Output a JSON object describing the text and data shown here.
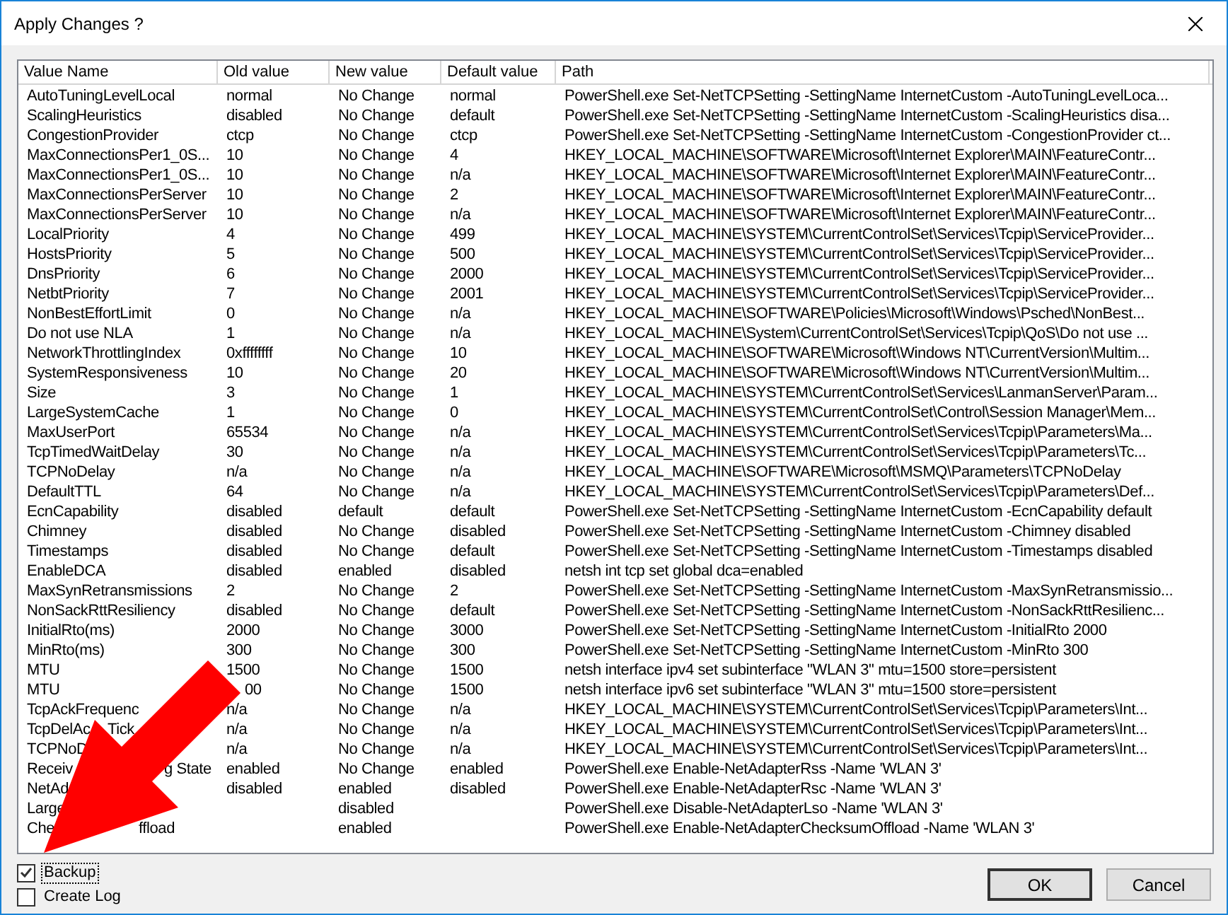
{
  "window": {
    "title": "Apply Changes ?"
  },
  "table": {
    "columns": [
      "Value Name",
      "Old value",
      "New value",
      "Default value",
      "Path"
    ],
    "rows": [
      {
        "name": [
          "AutoTuningLevelLocal"
        ],
        "old": "normal",
        "new": "No Change",
        "default": "normal",
        "path": "PowerShell.exe Set-NetTCPSetting -SettingName InternetCustom -AutoTuningLevelLoca..."
      },
      {
        "name": [
          "ScalingHeuristics"
        ],
        "old": "disabled",
        "new": "No Change",
        "default": "default",
        "path": "PowerShell.exe Set-NetTCPSetting -SettingName InternetCustom -ScalingHeuristics disa..."
      },
      {
        "name": [
          "CongestionProvider"
        ],
        "old": "ctcp",
        "new": "No Change",
        "default": "ctcp",
        "path": "PowerShell.exe Set-NetTCPSetting -SettingName InternetCustom -CongestionProvider ct..."
      },
      {
        "name": [
          "MaxConnectionsPer1_0S..."
        ],
        "old": "10",
        "new": "No Change",
        "default": "4",
        "path": "HKEY_LOCAL_MACHINE\\SOFTWARE\\Microsoft\\Internet Explorer\\MAIN\\FeatureContr..."
      },
      {
        "name": [
          "MaxConnectionsPer1_0S..."
        ],
        "old": "10",
        "new": "No Change",
        "default": "n/a",
        "path": "HKEY_LOCAL_MACHINE\\SOFTWARE\\Microsoft\\Internet Explorer\\MAIN\\FeatureContr..."
      },
      {
        "name": [
          "MaxConnectionsPerServer"
        ],
        "old": "10",
        "new": "No Change",
        "default": "2",
        "path": "HKEY_LOCAL_MACHINE\\SOFTWARE\\Microsoft\\Internet Explorer\\MAIN\\FeatureContr..."
      },
      {
        "name": [
          "MaxConnectionsPerServer"
        ],
        "old": "10",
        "new": "No Change",
        "default": "n/a",
        "path": "HKEY_LOCAL_MACHINE\\SOFTWARE\\Microsoft\\Internet Explorer\\MAIN\\FeatureContr..."
      },
      {
        "name": [
          "LocalPriority"
        ],
        "old": "4",
        "new": "No Change",
        "default": "499",
        "path": "HKEY_LOCAL_MACHINE\\SYSTEM\\CurrentControlSet\\Services\\Tcpip\\ServiceProvider..."
      },
      {
        "name": [
          "HostsPriority"
        ],
        "old": "5",
        "new": "No Change",
        "default": "500",
        "path": "HKEY_LOCAL_MACHINE\\SYSTEM\\CurrentControlSet\\Services\\Tcpip\\ServiceProvider..."
      },
      {
        "name": [
          "DnsPriority"
        ],
        "old": "6",
        "new": "No Change",
        "default": "2000",
        "path": "HKEY_LOCAL_MACHINE\\SYSTEM\\CurrentControlSet\\Services\\Tcpip\\ServiceProvider..."
      },
      {
        "name": [
          "NetbtPriority"
        ],
        "old": "7",
        "new": "No Change",
        "default": "2001",
        "path": "HKEY_LOCAL_MACHINE\\SYSTEM\\CurrentControlSet\\Services\\Tcpip\\ServiceProvider..."
      },
      {
        "name": [
          "NonBestEffortLimit"
        ],
        "old": "0",
        "new": "No Change",
        "default": "n/a",
        "path": "HKEY_LOCAL_MACHINE\\SOFTWARE\\Policies\\Microsoft\\Windows\\Psched\\NonBest..."
      },
      {
        "name": [
          "Do not use NLA"
        ],
        "old": "1",
        "new": "No Change",
        "default": "n/a",
        "path": "HKEY_LOCAL_MACHINE\\System\\CurrentControlSet\\Services\\Tcpip\\QoS\\Do not use ..."
      },
      {
        "name": [
          "NetworkThrottlingIndex"
        ],
        "old": "0xffffffff",
        "new": "No Change",
        "default": "10",
        "path": "HKEY_LOCAL_MACHINE\\SOFTWARE\\Microsoft\\Windows NT\\CurrentVersion\\Multim..."
      },
      {
        "name": [
          "SystemResponsiveness"
        ],
        "old": "10",
        "new": "No Change",
        "default": "20",
        "path": "HKEY_LOCAL_MACHINE\\SOFTWARE\\Microsoft\\Windows NT\\CurrentVersion\\Multim..."
      },
      {
        "name": [
          "Size"
        ],
        "old": "3",
        "new": "No Change",
        "default": "1",
        "path": "HKEY_LOCAL_MACHINE\\SYSTEM\\CurrentControlSet\\Services\\LanmanServer\\Param..."
      },
      {
        "name": [
          "LargeSystemCache"
        ],
        "old": "1",
        "new": "No Change",
        "default": "0",
        "path": "HKEY_LOCAL_MACHINE\\SYSTEM\\CurrentControlSet\\Control\\Session Manager\\Mem..."
      },
      {
        "name": [
          "MaxUserPort"
        ],
        "old": "65534",
        "new": "No Change",
        "default": "n/a",
        "path": "HKEY_LOCAL_MACHINE\\SYSTEM\\CurrentControlSet\\Services\\Tcpip\\Parameters\\Ma..."
      },
      {
        "name": [
          "TcpTimedWaitDelay"
        ],
        "old": "30",
        "new": "No Change",
        "default": "n/a",
        "path": "HKEY_LOCAL_MACHINE\\SYSTEM\\CurrentControlSet\\Services\\Tcpip\\Parameters\\Tc..."
      },
      {
        "name": [
          "TCPNoDelay"
        ],
        "old": "n/a",
        "new": "No Change",
        "default": "n/a",
        "path": "HKEY_LOCAL_MACHINE\\SOFTWARE\\Microsoft\\MSMQ\\Parameters\\TCPNoDelay"
      },
      {
        "name": [
          "DefaultTTL"
        ],
        "old": "64",
        "new": "No Change",
        "default": "n/a",
        "path": "HKEY_LOCAL_MACHINE\\SYSTEM\\CurrentControlSet\\Services\\Tcpip\\Parameters\\Def..."
      },
      {
        "name": [
          "EcnCapability"
        ],
        "old": "disabled",
        "new": "default",
        "default": "default",
        "path": "PowerShell.exe Set-NetTCPSetting -SettingName InternetCustom -EcnCapability default"
      },
      {
        "name": [
          "Chimney"
        ],
        "old": "disabled",
        "new": "No Change",
        "default": "disabled",
        "path": "PowerShell.exe Set-NetTCPSetting -SettingName InternetCustom -Chimney disabled"
      },
      {
        "name": [
          "Timestamps"
        ],
        "old": "disabled",
        "new": "No Change",
        "default": "default",
        "path": "PowerShell.exe Set-NetTCPSetting -SettingName InternetCustom -Timestamps disabled"
      },
      {
        "name": [
          "EnableDCA"
        ],
        "old": "disabled",
        "new": "enabled",
        "default": "disabled",
        "path": "netsh int tcp set global dca=enabled"
      },
      {
        "name": [
          "MaxSynRetransmissions"
        ],
        "old": "2",
        "new": "No Change",
        "default": "2",
        "path": "PowerShell.exe Set-NetTCPSetting -SettingName InternetCustom -MaxSynRetransmissio..."
      },
      {
        "name": [
          "NonSackRttResiliency"
        ],
        "old": "disabled",
        "new": "No Change",
        "default": "default",
        "path": "PowerShell.exe Set-NetTCPSetting -SettingName InternetCustom -NonSackRttResilienc..."
      },
      {
        "name": [
          "InitialRto(ms)"
        ],
        "old": "2000",
        "new": "No Change",
        "default": "3000",
        "path": "PowerShell.exe Set-NetTCPSetting -SettingName InternetCustom -InitialRto 2000"
      },
      {
        "name": [
          "MinRto(ms)"
        ],
        "old": "300",
        "new": "No Change",
        "default": "300",
        "path": "PowerShell.exe Set-NetTCPSetting -SettingName InternetCustom -MinRto 300"
      },
      {
        "name": [
          "MTU"
        ],
        "old": "1500",
        "new": "No Change",
        "default": "1500",
        "path": "netsh interface ipv4 set subinterface \"WLAN 3\" mtu=1500 store=persistent"
      },
      {
        "name": [
          "MTU"
        ],
        "old": "00",
        "new": "No Change",
        "default": "1500",
        "path": "netsh interface ipv6 set subinterface \"WLAN 3\" mtu=1500 store=persistent"
      },
      {
        "name": [
          "TcpAckFrequenc"
        ],
        "old": "n/a",
        "new": "No Change",
        "default": "n/a",
        "path": "HKEY_LOCAL_MACHINE\\SYSTEM\\CurrentControlSet\\Services\\Tcpip\\Parameters\\Int..."
      },
      {
        "name": [
          "TcpDelAc",
          "Tick"
        ],
        "old": "n/a",
        "new": "No Change",
        "default": "n/a",
        "path": "HKEY_LOCAL_MACHINE\\SYSTEM\\CurrentControlSet\\Services\\Tcpip\\Parameters\\Int..."
      },
      {
        "name": [
          "TCPNoD"
        ],
        "old": "n/a",
        "new": "No Change",
        "default": "n/a",
        "path": "HKEY_LOCAL_MACHINE\\SYSTEM\\CurrentControlSet\\Services\\Tcpip\\Parameters\\Int..."
      },
      {
        "name": [
          "Receiv",
          "g State"
        ],
        "old": "enabled",
        "new": "No Change",
        "default": "enabled",
        "path": "PowerShell.exe Enable-NetAdapterRss -Name 'WLAN 3'"
      },
      {
        "name": [
          "NetAd"
        ],
        "old": "disabled",
        "new": "enabled",
        "default": "disabled",
        "path": "PowerShell.exe Enable-NetAdapterRsc -Name 'WLAN 3'"
      },
      {
        "name": [
          "Large"
        ],
        "new": "disabled",
        "path": "PowerShell.exe Disable-NetAdapterLso -Name 'WLAN 3'"
      },
      {
        "name": [
          "Che",
          "ffload"
        ],
        "new": "enabled",
        "path": "PowerShell.exe Enable-NetAdapterChecksumOffload -Name 'WLAN 3'"
      }
    ]
  },
  "options": [
    {
      "label": "Backup",
      "checked": true,
      "focused": true
    },
    {
      "label": "Create Log",
      "checked": false,
      "focused": false
    }
  ],
  "buttons": [
    {
      "label": "OK",
      "default": true
    },
    {
      "label": "Cancel",
      "default": false
    }
  ]
}
